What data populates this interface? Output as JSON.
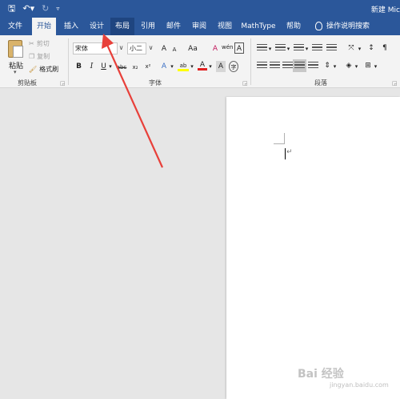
{
  "window": {
    "title": "新建 Mic"
  },
  "quick_access": {
    "save_icon": "save-icon",
    "undo_icon": "undo-icon",
    "redo_icon": "redo-icon",
    "customize_icon": "customize-qat-icon"
  },
  "tabs": [
    "文件",
    "开始",
    "插入",
    "设计",
    "布局",
    "引用",
    "邮件",
    "审阅",
    "视图",
    "MathType",
    "帮助"
  ],
  "active_tab": "开始",
  "tell_me": "操作说明搜索",
  "clipboard": {
    "paste": "粘贴",
    "cut": "剪切",
    "copy": "复制",
    "format_painter": "格式刷",
    "group_label": "剪贴板"
  },
  "font": {
    "name": "宋体",
    "size": "小二",
    "grow": "A",
    "shrink": "A",
    "case": "Aa",
    "clear_format": "A",
    "phonetic": "wén",
    "border_char": "A",
    "bold": "B",
    "italic": "I",
    "underline": "U",
    "strike": "abc",
    "subscript": "x₂",
    "superscript": "x²",
    "text_effect": "A",
    "highlight": "ab",
    "font_color": "A",
    "shading": "A",
    "enclose": "字",
    "group_label": "字体"
  },
  "paragraph": {
    "group_label": "段落"
  },
  "colors": {
    "accent": "#2b579a",
    "ribbon": "#f3f3f3",
    "canvas": "#e6e6e6",
    "arrow": "#e8403a",
    "highlight": "#ffff00",
    "font_red": "#e02020"
  },
  "document": {
    "paragraph_mark": "↵"
  },
  "watermark": {
    "main": "Bai 经验",
    "sub": "jingyan.baidu.com"
  }
}
